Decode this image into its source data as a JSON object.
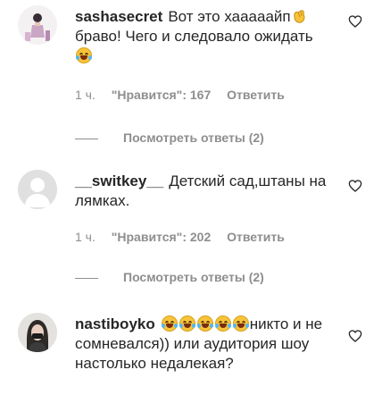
{
  "comments": [
    {
      "username": "sashasecret",
      "text_part1": "Вот это хааааайп",
      "text_part2": "браво! Чего и следовало ожидать",
      "time": "1 ч.",
      "likes": "\"Нравится\": 167",
      "reply": "Ответить",
      "view_replies": "Посмотреть ответы (2)"
    },
    {
      "username": "__switkey__",
      "text": "Детский сад,штаны на лямках.",
      "time": "1 ч.",
      "likes": "\"Нравится\": 202",
      "reply": "Ответить",
      "view_replies": "Посмотреть ответы (2)"
    },
    {
      "username": "nastiboyko",
      "text_after_emojis": "никто и не сомневался)) или аудитория шоу настолько недалекая?"
    }
  ],
  "icons": {
    "like": "heart-icon",
    "laugh": "face-with-tears-of-joy-emoji",
    "clap": "clapping-hands-emoji"
  },
  "colors": {
    "text": "#262626",
    "secondary": "#8e8e8e"
  }
}
